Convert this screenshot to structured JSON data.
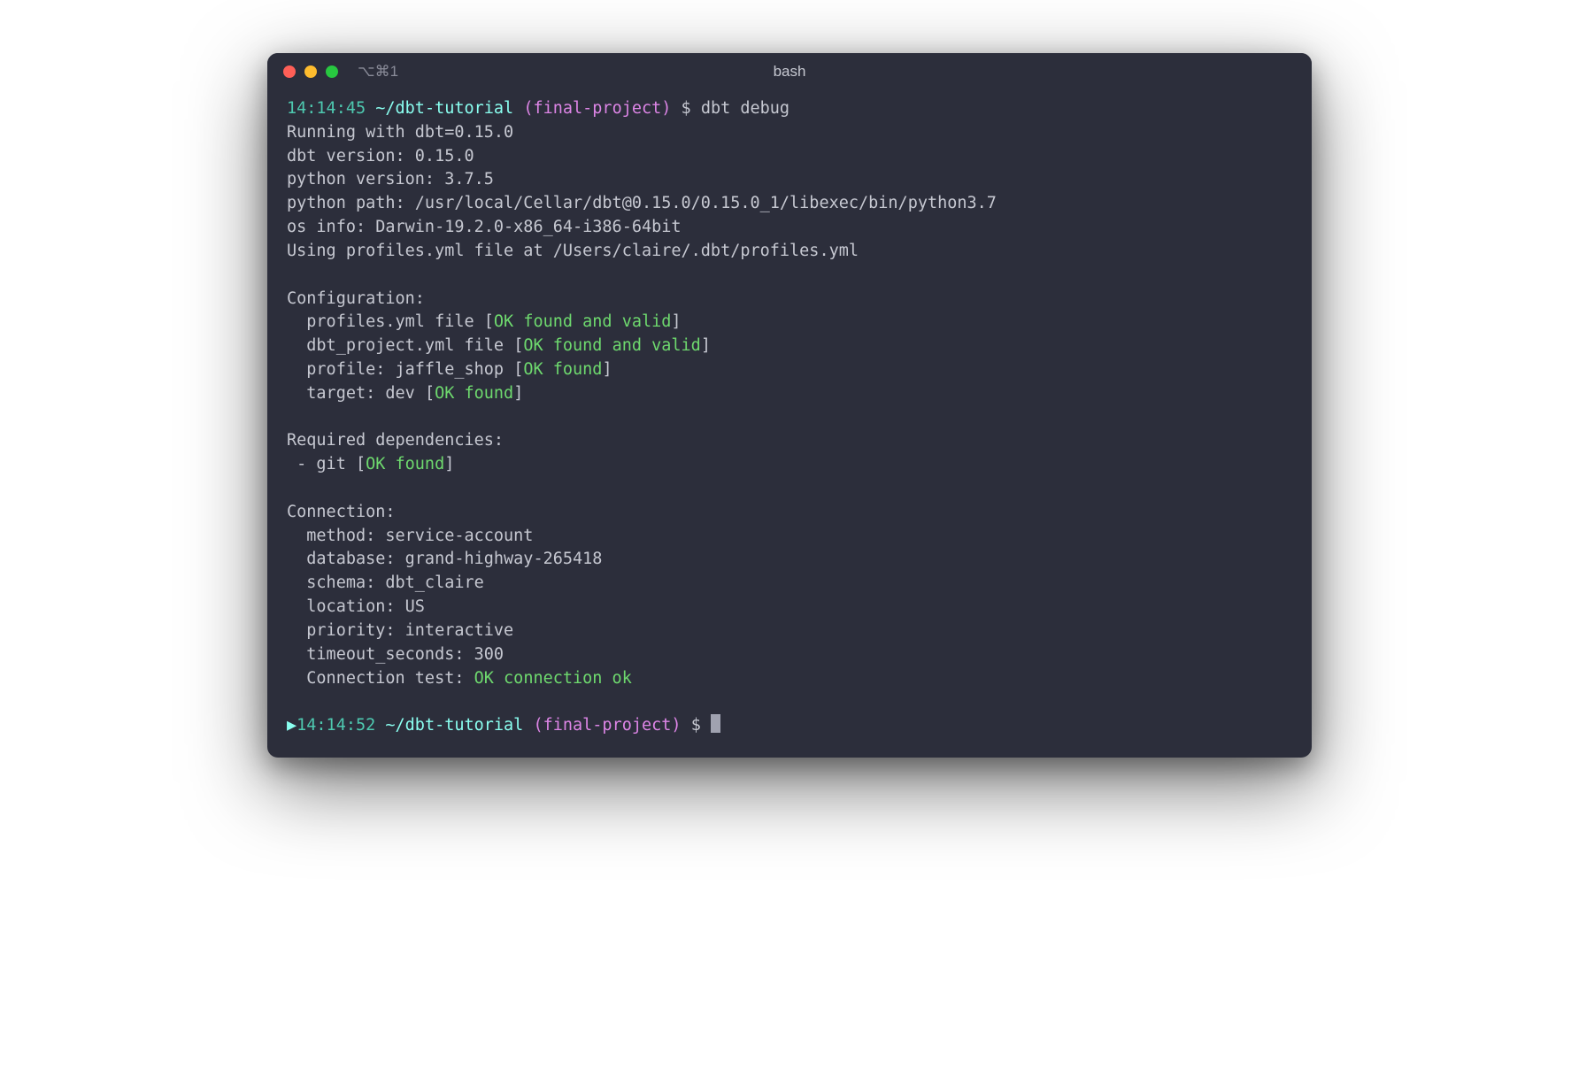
{
  "titlebar": {
    "shortcut": "⌥⌘1",
    "title": "bash"
  },
  "prompt1": {
    "ts": "14:14:45",
    "cwd": "~/dbt-tutorial",
    "branch": "(final-project)",
    "dollar": "$",
    "cmd": "dbt debug"
  },
  "out": {
    "l1": "Running with dbt=0.15.0",
    "l2": "dbt version: 0.15.0",
    "l3": "python version: 3.7.5",
    "l4": "python path: /usr/local/Cellar/dbt@0.15.0/0.15.0_1/libexec/bin/python3.7",
    "l5": "os info: Darwin-19.2.0-x86_64-i386-64bit",
    "l6": "Using profiles.yml file at /Users/claire/.dbt/profiles.yml",
    "cfg_hdr": "Configuration:",
    "cfg1_pre": "  profiles.yml file ",
    "cfg1_ok": "OK found and valid",
    "cfg2_pre": "  dbt_project.yml file ",
    "cfg2_ok": "OK found and valid",
    "cfg3_pre": "  profile: jaffle_shop ",
    "cfg3_ok": "OK found",
    "cfg4_pre": "  target: dev ",
    "cfg4_ok": "OK found",
    "dep_hdr": "Required dependencies:",
    "dep1_pre": " - git ",
    "dep1_ok": "OK found",
    "conn_hdr": "Connection:",
    "conn1": "  method: service-account",
    "conn2": "  database: grand-highway-265418",
    "conn3": "  schema: dbt_claire",
    "conn4": "  location: US",
    "conn5": "  priority: interactive",
    "conn6": "  timeout_seconds: 300",
    "conn7_pre": "  Connection test: ",
    "conn7_ok": "OK connection ok"
  },
  "prompt2": {
    "arrow": "▶",
    "ts": "14:14:52",
    "cwd": "~/dbt-tutorial",
    "branch": "(final-project)",
    "dollar": "$"
  },
  "brackets": {
    "open": "[",
    "close": "]"
  }
}
